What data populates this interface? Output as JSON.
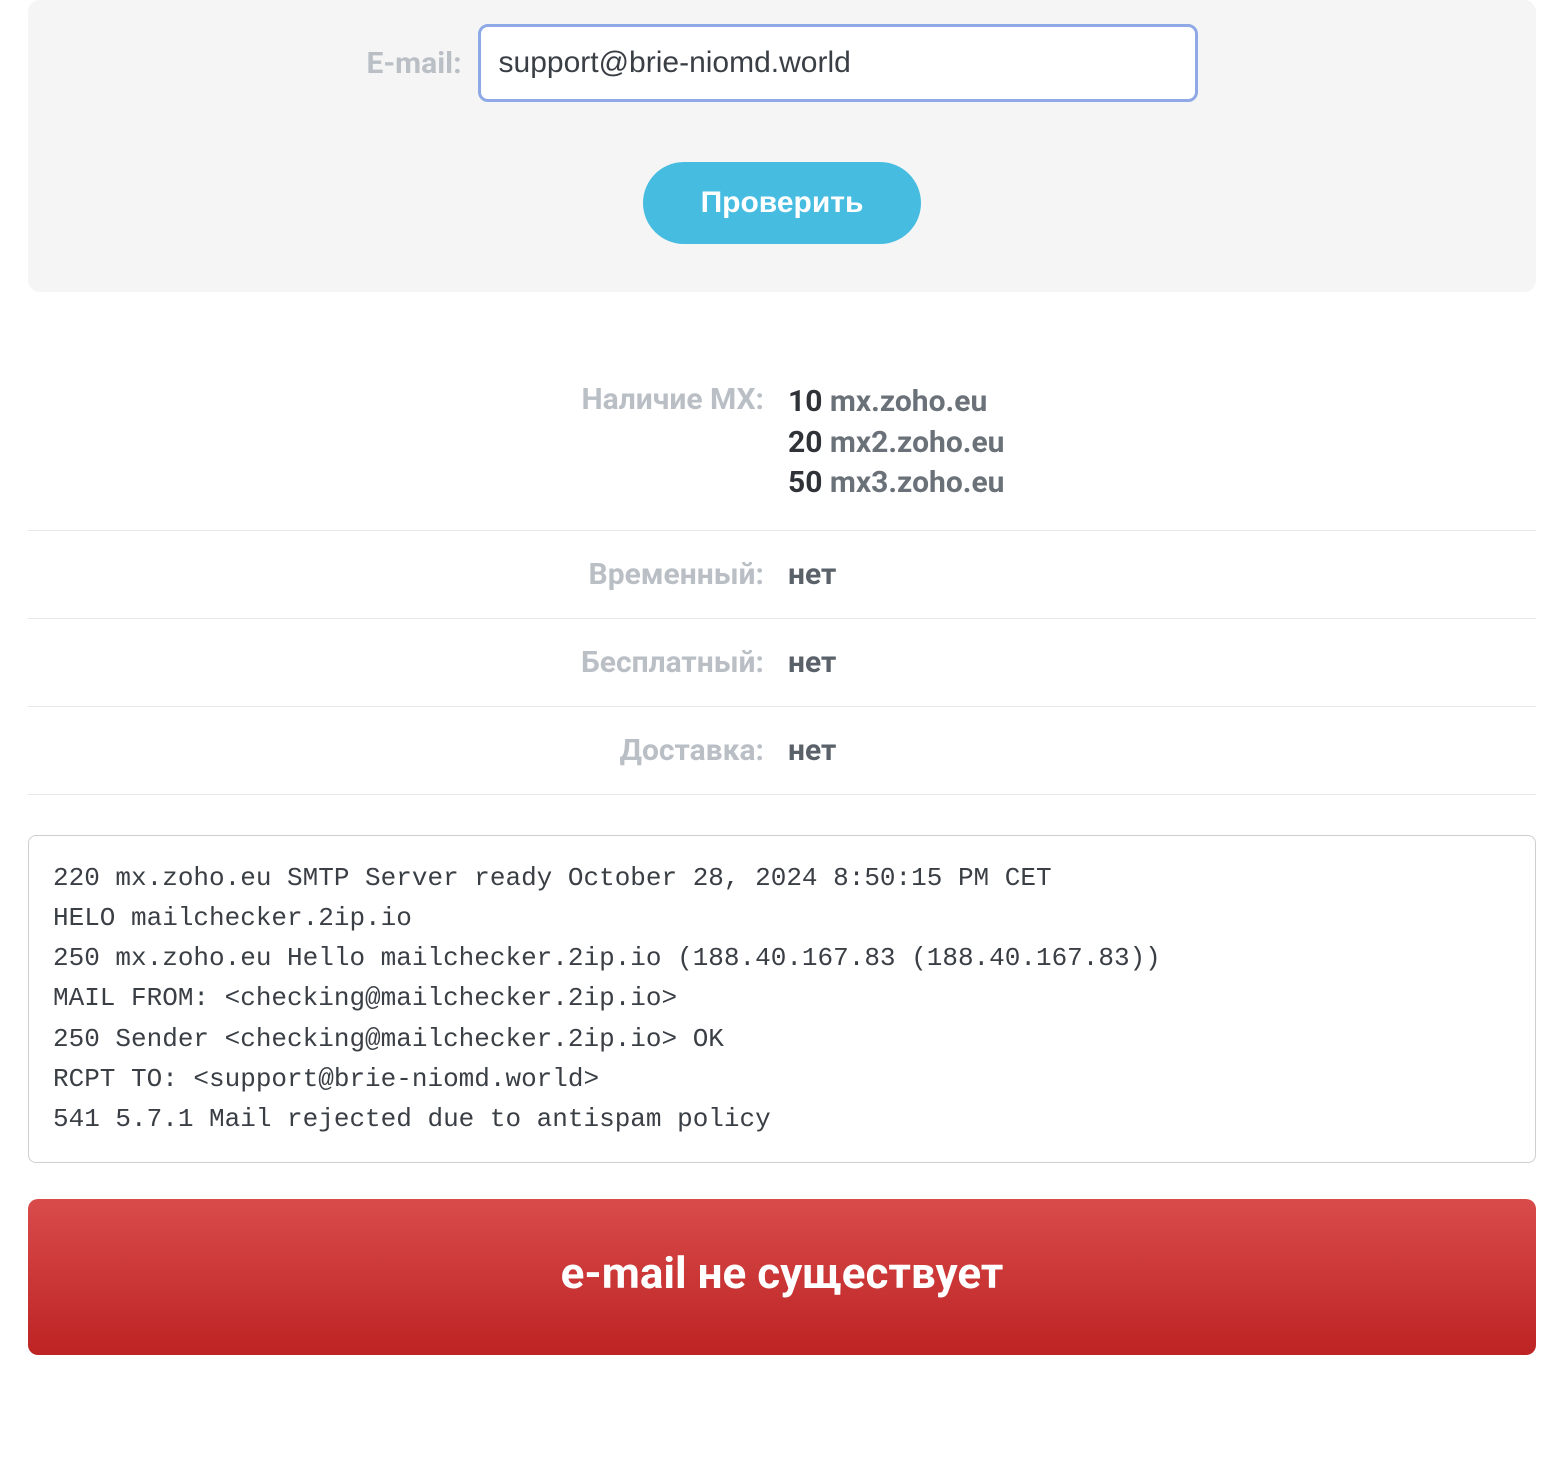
{
  "form": {
    "label": "E-mail:",
    "value": "support@brie-niomd.world",
    "submit": "Проверить"
  },
  "results": {
    "mx": {
      "label": "Наличие MX:",
      "records": [
        {
          "priority": "10",
          "host": "mx.zoho.eu"
        },
        {
          "priority": "20",
          "host": "mx2.zoho.eu"
        },
        {
          "priority": "50",
          "host": "mx3.zoho.eu"
        }
      ]
    },
    "temporary": {
      "label": "Временный:",
      "value": "нет"
    },
    "free": {
      "label": "Бесплатный:",
      "value": "нет"
    },
    "delivery": {
      "label": "Доставка:",
      "value": "нет"
    }
  },
  "smtp_log": "220 mx.zoho.eu SMTP Server ready October 28, 2024 8:50:15 PM CET\nHELO mailchecker.2ip.io\n250 mx.zoho.eu Hello mailchecker.2ip.io (188.40.167.83 (188.40.167.83))\nMAIL FROM: <checking@mailchecker.2ip.io>\n250 Sender <checking@mailchecker.2ip.io> OK\nRCPT TO: <support@brie-niomd.world>\n541 5.7.1 Mail rejected due to antispam policy",
  "banner": "e-mail не существует"
}
